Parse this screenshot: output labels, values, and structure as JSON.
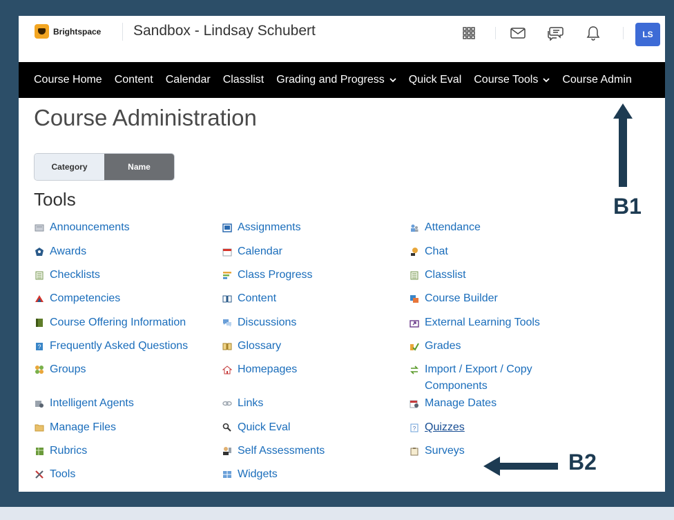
{
  "topbar": {
    "logo_text": "Brightspace",
    "org_title": "Sandbox - Lindsay Schubert",
    "avatar_initials": "LS",
    "icons": [
      "apps-grid-icon",
      "mail-icon",
      "chat-icon",
      "bell-icon"
    ]
  },
  "nav": {
    "items": [
      {
        "label": "Course Home",
        "dropdown": false
      },
      {
        "label": "Content",
        "dropdown": false
      },
      {
        "label": "Calendar",
        "dropdown": false
      },
      {
        "label": "Classlist",
        "dropdown": false
      },
      {
        "label": "Grading and Progress",
        "dropdown": true
      },
      {
        "label": "Quick Eval",
        "dropdown": false
      },
      {
        "label": "Course Tools",
        "dropdown": true
      },
      {
        "label": "Course Admin",
        "dropdown": false
      }
    ]
  },
  "page": {
    "title": "Course Administration",
    "toggle": {
      "category": "Category",
      "name": "Name",
      "selected": "Name"
    },
    "section_heading": "Tools"
  },
  "tools": [
    {
      "label": "Announcements",
      "icon": "announcements-icon"
    },
    {
      "label": "Assignments",
      "icon": "assignments-icon"
    },
    {
      "label": "Attendance",
      "icon": "attendance-icon"
    },
    {
      "label": "Awards",
      "icon": "awards-icon"
    },
    {
      "label": "Calendar",
      "icon": "calendar-icon"
    },
    {
      "label": "Chat",
      "icon": "chat-tool-icon"
    },
    {
      "label": "Checklists",
      "icon": "checklists-icon"
    },
    {
      "label": "Class Progress",
      "icon": "class-progress-icon"
    },
    {
      "label": "Classlist",
      "icon": "classlist-icon"
    },
    {
      "label": "Competencies",
      "icon": "competencies-icon"
    },
    {
      "label": "Content",
      "icon": "content-icon"
    },
    {
      "label": "Course Builder",
      "icon": "course-builder-icon"
    },
    {
      "label": "Course Offering Information",
      "icon": "course-offering-icon"
    },
    {
      "label": "Discussions",
      "icon": "discussions-icon"
    },
    {
      "label": "External Learning Tools",
      "icon": "external-tools-icon"
    },
    {
      "label": "Frequently Asked Questions",
      "icon": "faq-icon"
    },
    {
      "label": "Glossary",
      "icon": "glossary-icon"
    },
    {
      "label": "Grades",
      "icon": "grades-icon"
    },
    {
      "label": "Groups",
      "icon": "groups-icon"
    },
    {
      "label": "Homepages",
      "icon": "homepages-icon"
    },
    {
      "label": "Import / Export / Copy Components",
      "icon": "import-export-icon"
    },
    {
      "label": "Intelligent Agents",
      "icon": "intelligent-agents-icon"
    },
    {
      "label": "Links",
      "icon": "links-icon"
    },
    {
      "label": "Manage Dates",
      "icon": "manage-dates-icon"
    },
    {
      "label": "Manage Files",
      "icon": "manage-files-icon"
    },
    {
      "label": "Quick Eval",
      "icon": "quick-eval-icon"
    },
    {
      "label": "Quizzes",
      "icon": "quizzes-icon"
    },
    {
      "label": "Rubrics",
      "icon": "rubrics-icon"
    },
    {
      "label": "Self Assessments",
      "icon": "self-assessments-icon"
    },
    {
      "label": "Surveys",
      "icon": "surveys-icon"
    },
    {
      "label": "Tools",
      "icon": "tools-icon"
    },
    {
      "label": "Widgets",
      "icon": "widgets-icon"
    }
  ],
  "annotations": {
    "b1": "B1",
    "b2": "B2"
  },
  "colors": {
    "frame": "#2c4e68",
    "link": "#1a6dbb",
    "nav_bg": "#000000",
    "avatar": "#3d6bd6",
    "annotation": "#1d3b52"
  }
}
